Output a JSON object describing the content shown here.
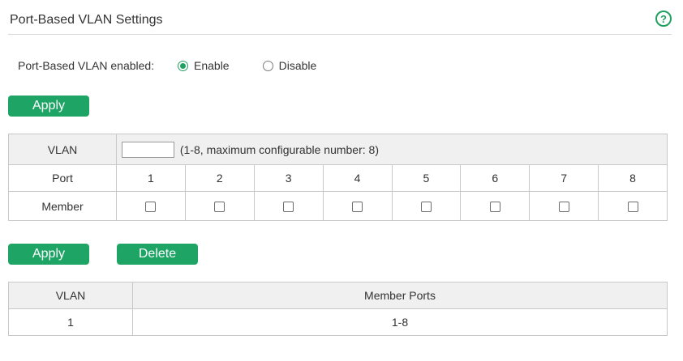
{
  "header": {
    "title": "Port-Based VLAN Settings",
    "help_icon": "question-circle-icon"
  },
  "enable_setting": {
    "label": "Port-Based VLAN enabled:",
    "options": [
      "Enable",
      "Disable"
    ],
    "selected": "Enable"
  },
  "buttons": {
    "apply_top": "Apply",
    "apply_bottom": "Apply",
    "delete": "Delete"
  },
  "config_table": {
    "vlan_label": "VLAN",
    "vlan_value": "",
    "vlan_hint": "(1-8, maximum configurable number: 8)",
    "port_label": "Port",
    "ports": [
      "1",
      "2",
      "3",
      "4",
      "5",
      "6",
      "7",
      "8"
    ],
    "member_label": "Member"
  },
  "vlan_list": {
    "columns": [
      "VLAN",
      "Member Ports"
    ],
    "rows": [
      {
        "vlan": "1",
        "members": "1-8"
      }
    ]
  },
  "colors": {
    "accent": "#1ea566"
  }
}
